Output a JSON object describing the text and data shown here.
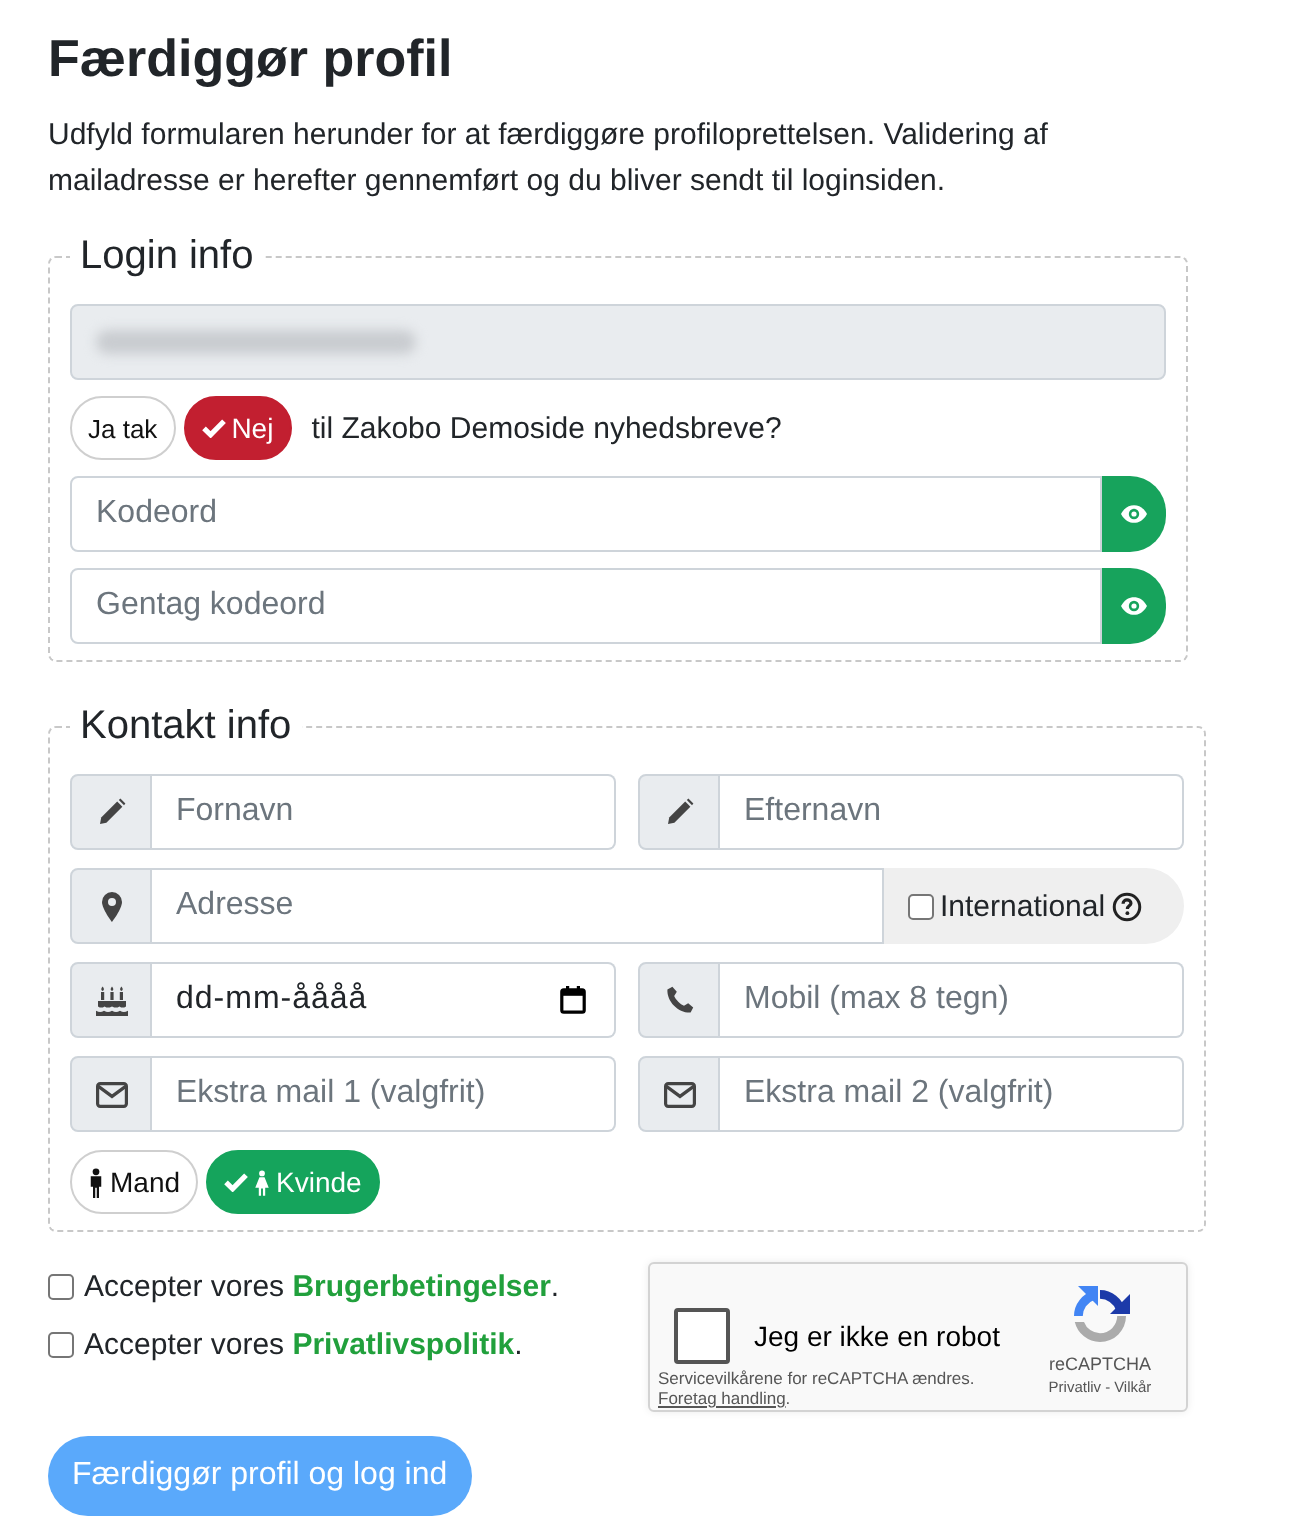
{
  "page": {
    "title": "Færdiggør profil",
    "intro": "Udfyld formularen herunder for at færdiggøre profiloprettelsen. Validering af mailadresse er herefter gennemført og du bliver sendt til loginsiden."
  },
  "login_info": {
    "legend": "Login info",
    "email_field": {
      "disabled": true,
      "value_blurred": true
    },
    "newsletter": {
      "options": [
        {
          "label": "Ja tak",
          "selected": false
        },
        {
          "label": "Nej",
          "selected": true
        }
      ],
      "text": "til Zakobo Demoside nyhedsbreve?"
    },
    "password_fields": [
      {
        "placeholder": "Kodeord"
      },
      {
        "placeholder": "Gentag kodeord"
      }
    ]
  },
  "contact_info": {
    "legend": "Kontakt info",
    "first_name": {
      "placeholder": "Fornavn"
    },
    "last_name": {
      "placeholder": "Efternavn"
    },
    "address": {
      "placeholder": "Adresse"
    },
    "international": {
      "label": "International",
      "checked": false
    },
    "birthdate": {
      "placeholder": "dd-mm-åååå"
    },
    "mobile": {
      "placeholder": "Mobil (max 8 tegn)"
    },
    "extra_mails": [
      {
        "placeholder": "Ekstra mail 1 (valgfrit)"
      },
      {
        "placeholder": "Ekstra mail 2 (valgfrit)"
      }
    ],
    "gender": [
      {
        "label": "Mand",
        "selected": false
      },
      {
        "label": "Kvinde",
        "selected": true
      }
    ]
  },
  "terms": [
    {
      "checked": false,
      "text": "Accepter vores",
      "link": "Brugerbetingelser",
      "after": "."
    },
    {
      "checked": false,
      "text": "Accepter vores",
      "link": "Privatlivspolitik",
      "after": "."
    }
  ],
  "recaptcha": {
    "checked": false,
    "label": "Jeg er ikke en robot",
    "notice": "Servicevilkårene for reCAPTCHA ændres.",
    "action_link": "Foretag handling",
    "action_after": ".",
    "brand": "reCAPTCHA",
    "privacy_link": "Privatliv",
    "separator": "-",
    "terms_link": "Vilkår"
  },
  "submit": {
    "label": "Færdiggør profil og log ind",
    "disabled": true
  }
}
